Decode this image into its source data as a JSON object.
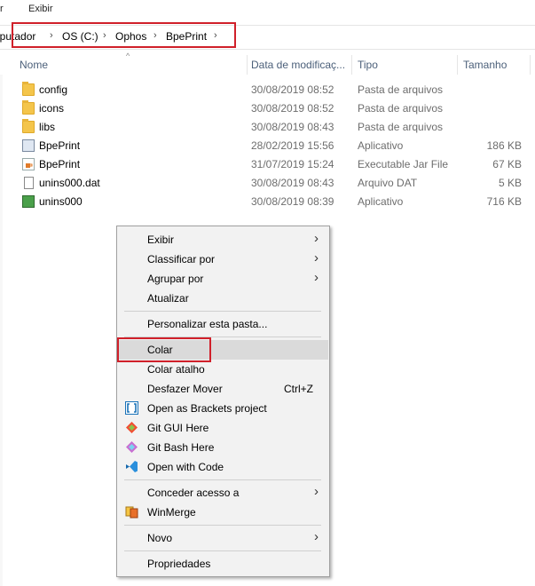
{
  "menubar": {
    "partial": "r",
    "exibir": "Exibir"
  },
  "breadcrumb": {
    "items": [
      "nputador",
      "OS (C:)",
      "Ophos",
      "BpePrint"
    ],
    "separator": "›"
  },
  "columns": {
    "name": "Nome",
    "date": "Data de modificaç...",
    "type": "Tipo",
    "size": "Tamanho",
    "sort_caret": "^"
  },
  "files": [
    {
      "name": "config",
      "date": "30/08/2019 08:52",
      "type": "Pasta de arquivos",
      "size": "",
      "icon": "folder-icon"
    },
    {
      "name": "icons",
      "date": "30/08/2019 08:52",
      "type": "Pasta de arquivos",
      "size": "",
      "icon": "folder-icon"
    },
    {
      "name": "libs",
      "date": "30/08/2019 08:43",
      "type": "Pasta de arquivos",
      "size": "",
      "icon": "folder-icon"
    },
    {
      "name": "BpePrint",
      "date": "28/02/2019 15:56",
      "type": "Aplicativo",
      "size": "186 KB",
      "icon": "application-icon"
    },
    {
      "name": "BpePrint",
      "date": "31/07/2019 15:24",
      "type": "Executable Jar File",
      "size": "67 KB",
      "icon": "jar-file-icon"
    },
    {
      "name": "unins000.dat",
      "date": "30/08/2019 08:43",
      "type": "Arquivo DAT",
      "size": "5 KB",
      "icon": "document-icon"
    },
    {
      "name": "unins000",
      "date": "30/08/2019 08:39",
      "type": "Aplicativo",
      "size": "716 KB",
      "icon": "uninstaller-icon"
    }
  ],
  "context_menu": {
    "exibir": "Exibir",
    "classificar": "Classificar por",
    "agrupar": "Agrupar por",
    "atualizar": "Atualizar",
    "personalizar": "Personalizar esta pasta...",
    "colar": "Colar",
    "colar_atalho": "Colar atalho",
    "desfazer": "Desfazer Mover",
    "desfazer_shortcut": "Ctrl+Z",
    "brackets": "Open as Brackets project",
    "git_gui": "Git GUI Here",
    "git_bash": "Git Bash Here",
    "vscode": "Open with Code",
    "conceder": "Conceder acesso a",
    "winmerge": "WinMerge",
    "novo": "Novo",
    "propriedades": "Propriedades",
    "submenu_arrow": "›"
  },
  "colors": {
    "highlight_box": "#d0202a",
    "menu_bg": "#f2f2f2",
    "menu_hover": "#dadada",
    "header_text": "#4c607a"
  }
}
